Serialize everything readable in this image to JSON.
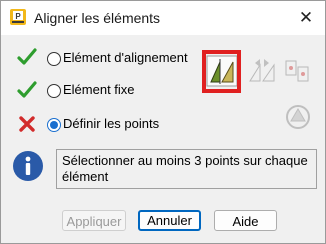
{
  "window": {
    "title": "Aligner les éléments",
    "close_glyph": "✕"
  },
  "options": [
    {
      "label": "Elément d'alignement",
      "status": "check",
      "selected": false
    },
    {
      "label": "Elément fixe",
      "status": "check",
      "selected": false
    },
    {
      "label": "Définir les points",
      "status": "cross",
      "selected": true
    }
  ],
  "toolbar": {
    "tools": [
      "align-triangle-tool",
      "align-mirror-tool",
      "align-points-tool",
      "align-rotate-tool"
    ]
  },
  "info": {
    "message": "Sélectionner au moins 3 points sur chaque élément"
  },
  "buttons": {
    "apply": "Appliquer",
    "cancel": "Annuler",
    "help": "Aide"
  },
  "colors": {
    "check": "#2e9d2e",
    "cross": "#d22b2b",
    "highlight": "#e02020",
    "info_icon": "#2a5aa8",
    "accent": "#0067c0"
  }
}
